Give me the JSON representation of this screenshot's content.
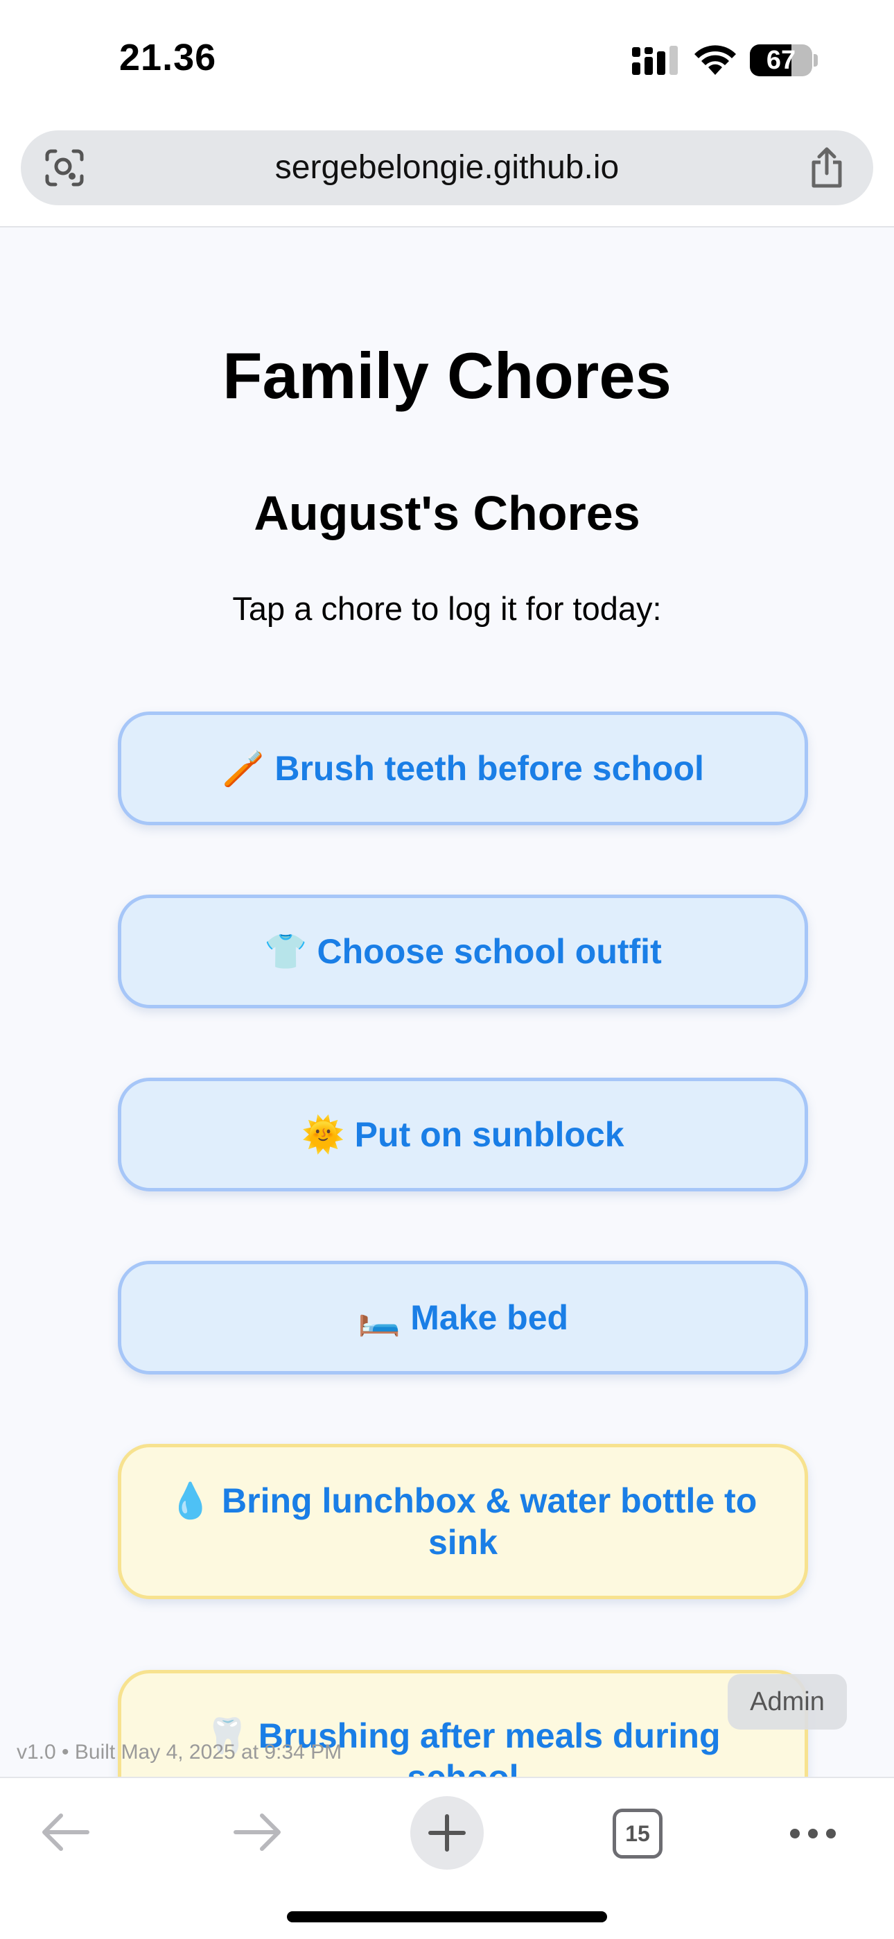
{
  "status_bar": {
    "time": "21.36",
    "battery_percent": "67",
    "battery_level": 0.67,
    "icons": [
      "cellular-signal-icon",
      "wifi-icon",
      "battery-icon"
    ]
  },
  "browser": {
    "url": "sergebelongie.github.io",
    "icons": [
      "visual-lookup-icon",
      "share-icon"
    ]
  },
  "page": {
    "title": "Family Chores",
    "subtitle": "August's Chores",
    "instruction": "Tap a chore to log it for today:",
    "chores": [
      {
        "emoji": "🪥",
        "label": "Brush teeth before school",
        "color": "#e0eefc"
      },
      {
        "emoji": "👕",
        "label": "Choose school outfit",
        "color": "#e0eefc"
      },
      {
        "emoji": "🌞",
        "label": "Put on sunblock",
        "color": "#e0eefc"
      },
      {
        "emoji": "🛏️",
        "label": "Make bed",
        "color": "#e0eefc"
      },
      {
        "emoji": "💧",
        "label": "Bring lunchbox & water bottle to sink",
        "color": "#fdf9df"
      },
      {
        "emoji": "🦷",
        "label": "Brushing after meals during school",
        "color": "#fdf9df"
      }
    ],
    "admin_label": "Admin",
    "version": "v1.0 • Built May 4, 2025 at 9:34 PM"
  },
  "toolbar": {
    "tab_count": "15",
    "icons": [
      "back-arrow-icon",
      "forward-arrow-icon",
      "plus-icon",
      "tabs-icon",
      "more-icon"
    ]
  },
  "colors": {
    "accent_text": "#1a7ee6",
    "blue_card": "#e0eefc",
    "blue_border": "#a6c6f8",
    "yellow_card": "#fdf9df",
    "yellow_border": "#f7e28f"
  }
}
